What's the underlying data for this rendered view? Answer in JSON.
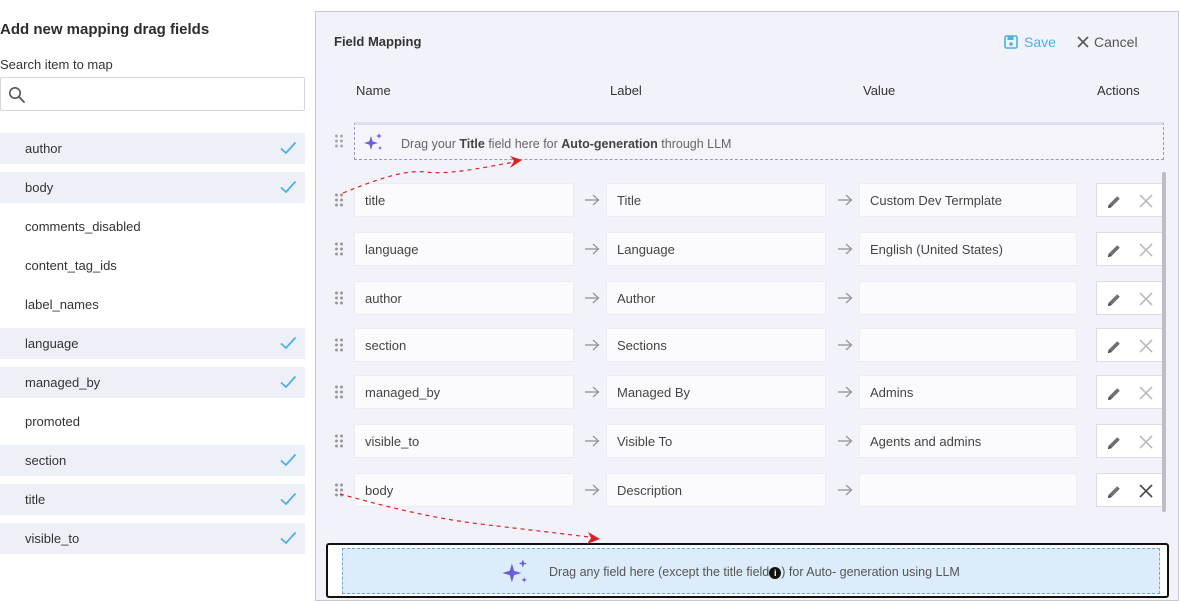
{
  "left_panel": {
    "title": "Add new mapping drag fields",
    "search_label": "Search item to map",
    "search_value": "",
    "search_placeholder": "",
    "items": [
      {
        "label": "author",
        "mapped": true
      },
      {
        "label": "body",
        "mapped": true
      },
      {
        "label": "comments_disabled",
        "mapped": false
      },
      {
        "label": "content_tag_ids",
        "mapped": false
      },
      {
        "label": "label_names",
        "mapped": false
      },
      {
        "label": "language",
        "mapped": true
      },
      {
        "label": "managed_by",
        "mapped": true
      },
      {
        "label": "promoted",
        "mapped": false
      },
      {
        "label": "section",
        "mapped": true
      },
      {
        "label": "title",
        "mapped": true
      },
      {
        "label": "visible_to",
        "mapped": true
      }
    ]
  },
  "field_mapping": {
    "title": "Field Mapping",
    "save_label": "Save",
    "cancel_label": "Cancel",
    "columns": {
      "name": "Name",
      "label": "Label",
      "value": "Value",
      "actions": "Actions"
    },
    "llm_title_drop": {
      "prefix": "Drag your ",
      "bold1": "Title",
      "middle": " field here for ",
      "bold2": "Auto-generation",
      "suffix": " through LLM"
    },
    "rows": [
      {
        "name": "title",
        "label": "Title",
        "value": "Custom Dev Termplate"
      },
      {
        "name": "language",
        "label": "Language",
        "value": "English (United States)"
      },
      {
        "name": "author",
        "label": "Author",
        "value": ""
      },
      {
        "name": "section",
        "label": "Sections",
        "value": ""
      },
      {
        "name": "managed_by",
        "label": "Managed By",
        "value": "Admins"
      },
      {
        "name": "visible_to",
        "label": "Visible To",
        "value": "Agents and admins"
      },
      {
        "name": "body",
        "label": "Description",
        "value": ""
      }
    ],
    "llm_any_drop": {
      "prefix": "Drag any field here (except the title field",
      "suffix": ") for Auto- generation using LLM"
    }
  },
  "colors": {
    "accent": "#4ab0e6",
    "check": "#4ab0e6",
    "sparkle": "#6b5fd6",
    "arrow_annotation": "#e02020"
  }
}
